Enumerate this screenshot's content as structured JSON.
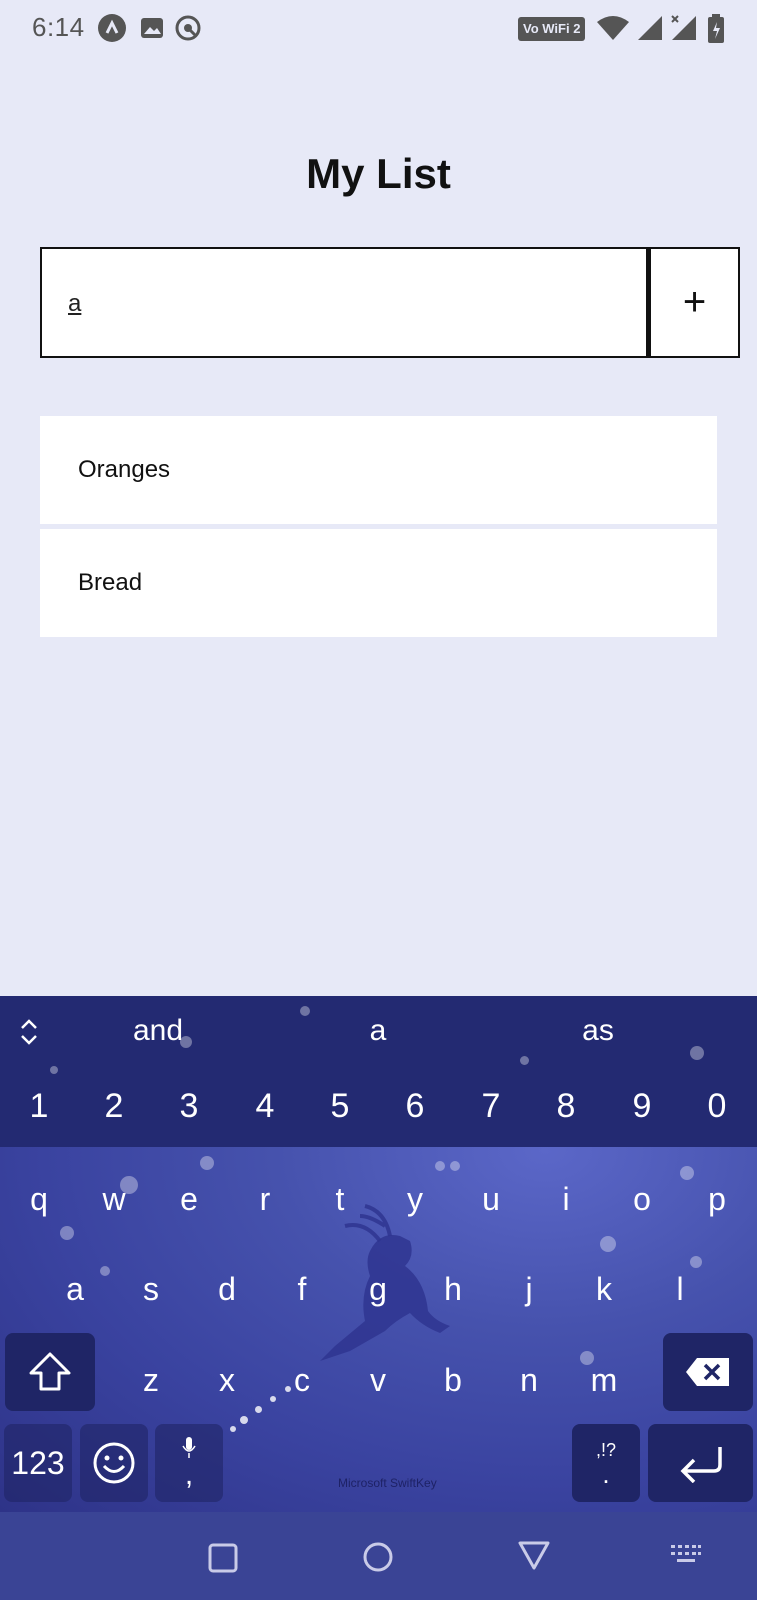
{
  "status_bar": {
    "time": "6:14",
    "wifi_label": "Vo WiFi 2",
    "icons": [
      "navigation-icon",
      "image-icon",
      "sync-icon",
      "wifi-icon",
      "signal-icon",
      "signal-x-icon",
      "battery-icon"
    ]
  },
  "app": {
    "title": "My List",
    "input": {
      "value": "a",
      "placeholder": ""
    },
    "add_button_label": "+",
    "items": [
      {
        "label": "Oranges"
      },
      {
        "label": "Bread"
      }
    ]
  },
  "keyboard": {
    "suggestions": [
      "and",
      "a",
      "as"
    ],
    "number_row": [
      "1",
      "2",
      "3",
      "4",
      "5",
      "6",
      "7",
      "8",
      "9",
      "0"
    ],
    "row1": [
      "q",
      "w",
      "e",
      "r",
      "t",
      "y",
      "u",
      "i",
      "o",
      "p"
    ],
    "row2": [
      "a",
      "s",
      "d",
      "f",
      "g",
      "h",
      "j",
      "k",
      "l"
    ],
    "row3": [
      "z",
      "x",
      "c",
      "v",
      "b",
      "n",
      "m"
    ],
    "mode_key": "123",
    "comma_key": ",",
    "punct_key_top": ",!?",
    "punct_key_bottom": ".",
    "brand": "Microsoft SwiftKey"
  },
  "colors": {
    "background": "#e7e9f7",
    "keyboard_top": "#232a72",
    "keyboard_body": "#4652ad",
    "nav_bar": "#3a4495"
  }
}
